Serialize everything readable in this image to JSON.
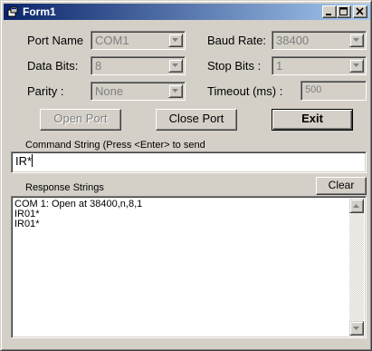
{
  "window": {
    "title": "Form1",
    "controls": {
      "minimize_icon": "minimize-icon",
      "maximize_icon": "maximize-icon",
      "close_icon": "close-icon"
    }
  },
  "settings": {
    "port_name": {
      "label": "Port Name",
      "value": "COM1"
    },
    "baud_rate": {
      "label": "Baud Rate:",
      "value": "38400"
    },
    "data_bits": {
      "label": "Data Bits:",
      "value": "8"
    },
    "stop_bits": {
      "label": "Stop Bits :",
      "value": "1"
    },
    "parity": {
      "label": "Parity :",
      "value": "None"
    },
    "timeout": {
      "label": "Timeout (ms) :",
      "value": "500"
    }
  },
  "buttons": {
    "open_port": "Open Port",
    "close_port": "Close Port",
    "exit": "Exit",
    "clear": "Clear"
  },
  "command": {
    "label": "Command String (Press <Enter> to send",
    "value": "IR*"
  },
  "response": {
    "label": "Response Strings",
    "lines": [
      "COM 1: Open at 38400,n,8,1",
      "IR01*",
      "IR01*"
    ]
  },
  "colors": {
    "face": "#d4d0c8",
    "title_gradient_start": "#0a246a",
    "title_gradient_end": "#a6caf0",
    "disabled_text": "#808080"
  }
}
